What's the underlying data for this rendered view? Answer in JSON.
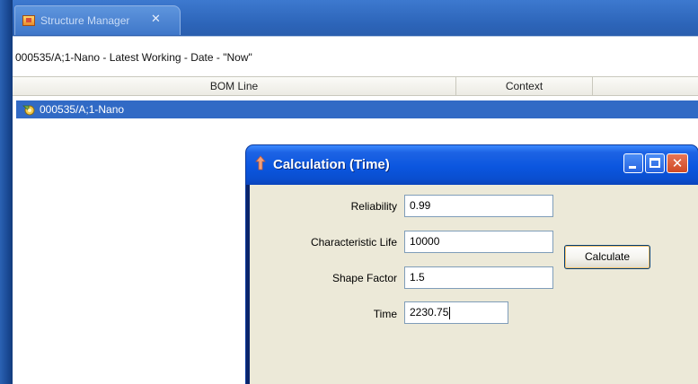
{
  "tab": {
    "title": "Structure Manager",
    "close_symbol": "✕",
    "icon": "structure-manager-icon"
  },
  "panel": {
    "title": "000535/A;1-Nano - Latest Working - Date - \"Now\"",
    "columns": [
      "BOM Line",
      "Context",
      ""
    ],
    "rows": [
      {
        "label": "000535/A;1-Nano",
        "icon": "item-revision-icon",
        "selected": true
      }
    ],
    "selection_color": "#316ac5"
  },
  "dialog": {
    "title": "Calculation (Time)",
    "icon": "calculation-icon",
    "fields": [
      {
        "label": "Reliability",
        "value": "0.99"
      },
      {
        "label": "Characteristic Life",
        "value": "10000"
      },
      {
        "label": "Shape Factor",
        "value": "1.5"
      },
      {
        "label": "Time",
        "value": "2230.75"
      }
    ],
    "calculate_label": "Calculate",
    "window_buttons": {
      "minimize": "minimize-icon",
      "maximize": "maximize-icon",
      "close": "close-icon",
      "close_symbol": "✕"
    }
  },
  "colors": {
    "frame_blue": "#1d4f9a",
    "titlebar_blue": "#0b56df",
    "dialog_body": "#ece9d8"
  }
}
